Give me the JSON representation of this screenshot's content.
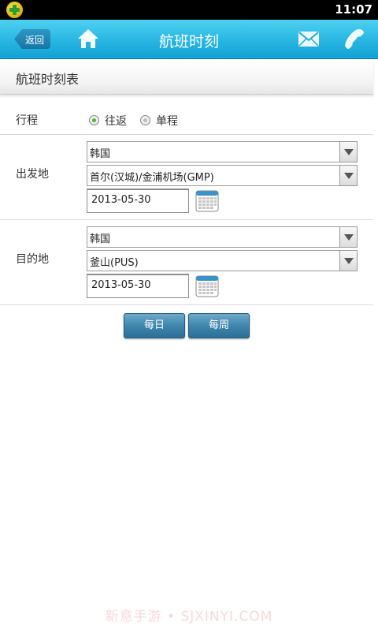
{
  "status_bar": {
    "time": "11:07",
    "app_icon": "plus-app-icon"
  },
  "title_bar": {
    "back_label": "返回",
    "title": "航班时刻",
    "icons": [
      "home-icon",
      "mail-icon",
      "phone-icon"
    ]
  },
  "section": {
    "title": "航班时刻表"
  },
  "trip": {
    "label": "行程",
    "options": [
      {
        "label": "往返",
        "selected": true
      },
      {
        "label": "单程",
        "selected": false
      }
    ]
  },
  "departure": {
    "label": "出发地",
    "country": "韩国",
    "airport": "首尔(汉城)/金浦机场(GMP)",
    "date": "2013-05-30"
  },
  "destination": {
    "label": "目的地",
    "country": "韩国",
    "airport": "釜山(PUS)",
    "date": "2013-05-30"
  },
  "actions": {
    "daily": "每日",
    "weekly": "每周"
  },
  "watermark": "新意手游 • SJXINYI.COM",
  "colors": {
    "title_bar": "#27b6e2",
    "button": "#3f86ad",
    "radio_selected": "#4cb82f"
  }
}
